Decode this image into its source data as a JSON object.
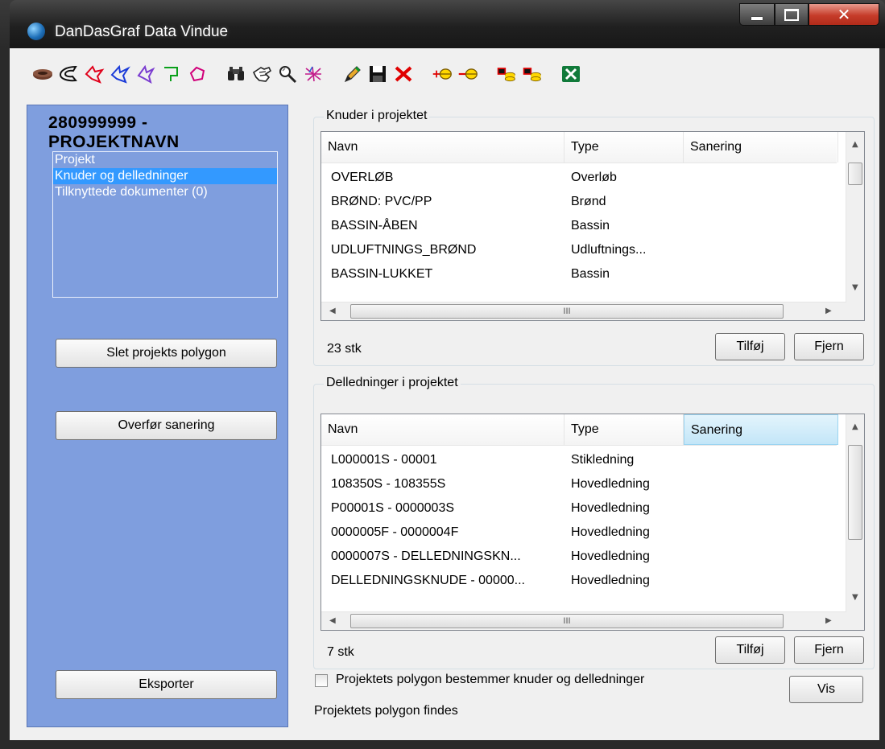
{
  "window": {
    "title": "DanDasGraf  Data Vindue"
  },
  "toolbar": {
    "icons": [
      "disk-icon",
      "boomerang-icon",
      "red-polygon-icon",
      "blue-polygon-icon",
      "green-polygon-icon",
      "pink-polygon-icon",
      "binoculars-icon",
      "hand-select-icon",
      "magnifier-icon",
      "network-icon",
      "pencil-icon",
      "save-icon",
      "delete-icon",
      "add-node-icon",
      "remove-node-icon",
      "add-db-icon",
      "remove-db-icon",
      "excel-export-icon"
    ]
  },
  "left": {
    "project_id": "280999999 -",
    "project_name": "PROJEKTNAVN",
    "nav": [
      {
        "label": "Projekt",
        "selected": false
      },
      {
        "label": "Knuder og delledninger",
        "selected": true
      },
      {
        "label": "Tilknyttede dokumenter (0)",
        "selected": false
      }
    ],
    "btn_delete_polygon": "Slet projekts polygon",
    "btn_transfer": "Overfør sanering",
    "btn_export": "Eksporter"
  },
  "knuder": {
    "legend": "Knuder i projektet",
    "columns": [
      "Navn",
      "Type",
      "Sanering"
    ],
    "rows": [
      [
        "OVERLØB",
        "Overløb",
        ""
      ],
      [
        "BRØND: PVC/PP",
        "Brønd",
        ""
      ],
      [
        "BASSIN-ÅBEN",
        "Bassin",
        ""
      ],
      [
        "UDLUFTNINGS_BRØND",
        "Udluftnings...",
        ""
      ],
      [
        "BASSIN-LUKKET",
        "Bassin",
        ""
      ]
    ],
    "count": "23 stk",
    "btn_add": "Tilføj",
    "btn_remove": "Fjern",
    "scroll_glyph": "III"
  },
  "delledninger": {
    "legend": "Delledninger i projektet",
    "columns": [
      "Navn",
      "Type",
      "Sanering"
    ],
    "rows": [
      [
        "L000001S - 00001",
        "Stikledning",
        ""
      ],
      [
        "108350S - 108355S",
        "Hovedledning",
        ""
      ],
      [
        "P00001S - 0000003S",
        "Hovedledning",
        ""
      ],
      [
        "0000005F - 0000004F",
        "Hovedledning",
        ""
      ],
      [
        "0000007S - DELLEDNINGSKN...",
        "Hovedledning",
        ""
      ],
      [
        "DELLEDNINGSKNUDE - 00000...",
        "Hovedledning",
        ""
      ]
    ],
    "count": "7 stk",
    "btn_add": "Tilføj",
    "btn_remove": "Fjern",
    "scroll_glyph": "III"
  },
  "footer": {
    "checkbox_label": "Projektets polygon bestemmer knuder og delledninger",
    "checkbox_checked": false,
    "btn_show": "Vis",
    "status": "Projektets polygon findes"
  }
}
